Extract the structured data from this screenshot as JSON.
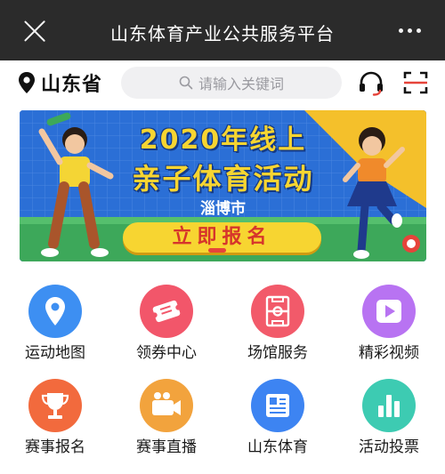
{
  "app_bar": {
    "title": "山东体育产业公共服务平台"
  },
  "location": {
    "label": "山东省"
  },
  "search": {
    "placeholder": "请输入关键词"
  },
  "banner": {
    "title_line1": "2020年线上",
    "title_line2": "亲子体育活动",
    "city": "淄博市",
    "cta": "立即报名"
  },
  "services": [
    {
      "label": "运动地图",
      "icon": "map-pin-icon",
      "color": "#3d8ff2"
    },
    {
      "label": "领券中心",
      "icon": "coupon-icon",
      "color": "#f2566a"
    },
    {
      "label": "场馆服务",
      "icon": "court-icon",
      "color": "#f25a6a"
    },
    {
      "label": "精彩视频",
      "icon": "play-icon",
      "color": "#b873f2"
    },
    {
      "label": "赛事报名",
      "icon": "trophy-icon",
      "color": "#f26a3d"
    },
    {
      "label": "赛事直播",
      "icon": "camera-icon",
      "color": "#f2a33d"
    },
    {
      "label": "山东体育",
      "icon": "newspaper-icon",
      "color": "#3d84f2"
    },
    {
      "label": "活动投票",
      "icon": "bar-chart-icon",
      "color": "#3dcbb2"
    }
  ]
}
